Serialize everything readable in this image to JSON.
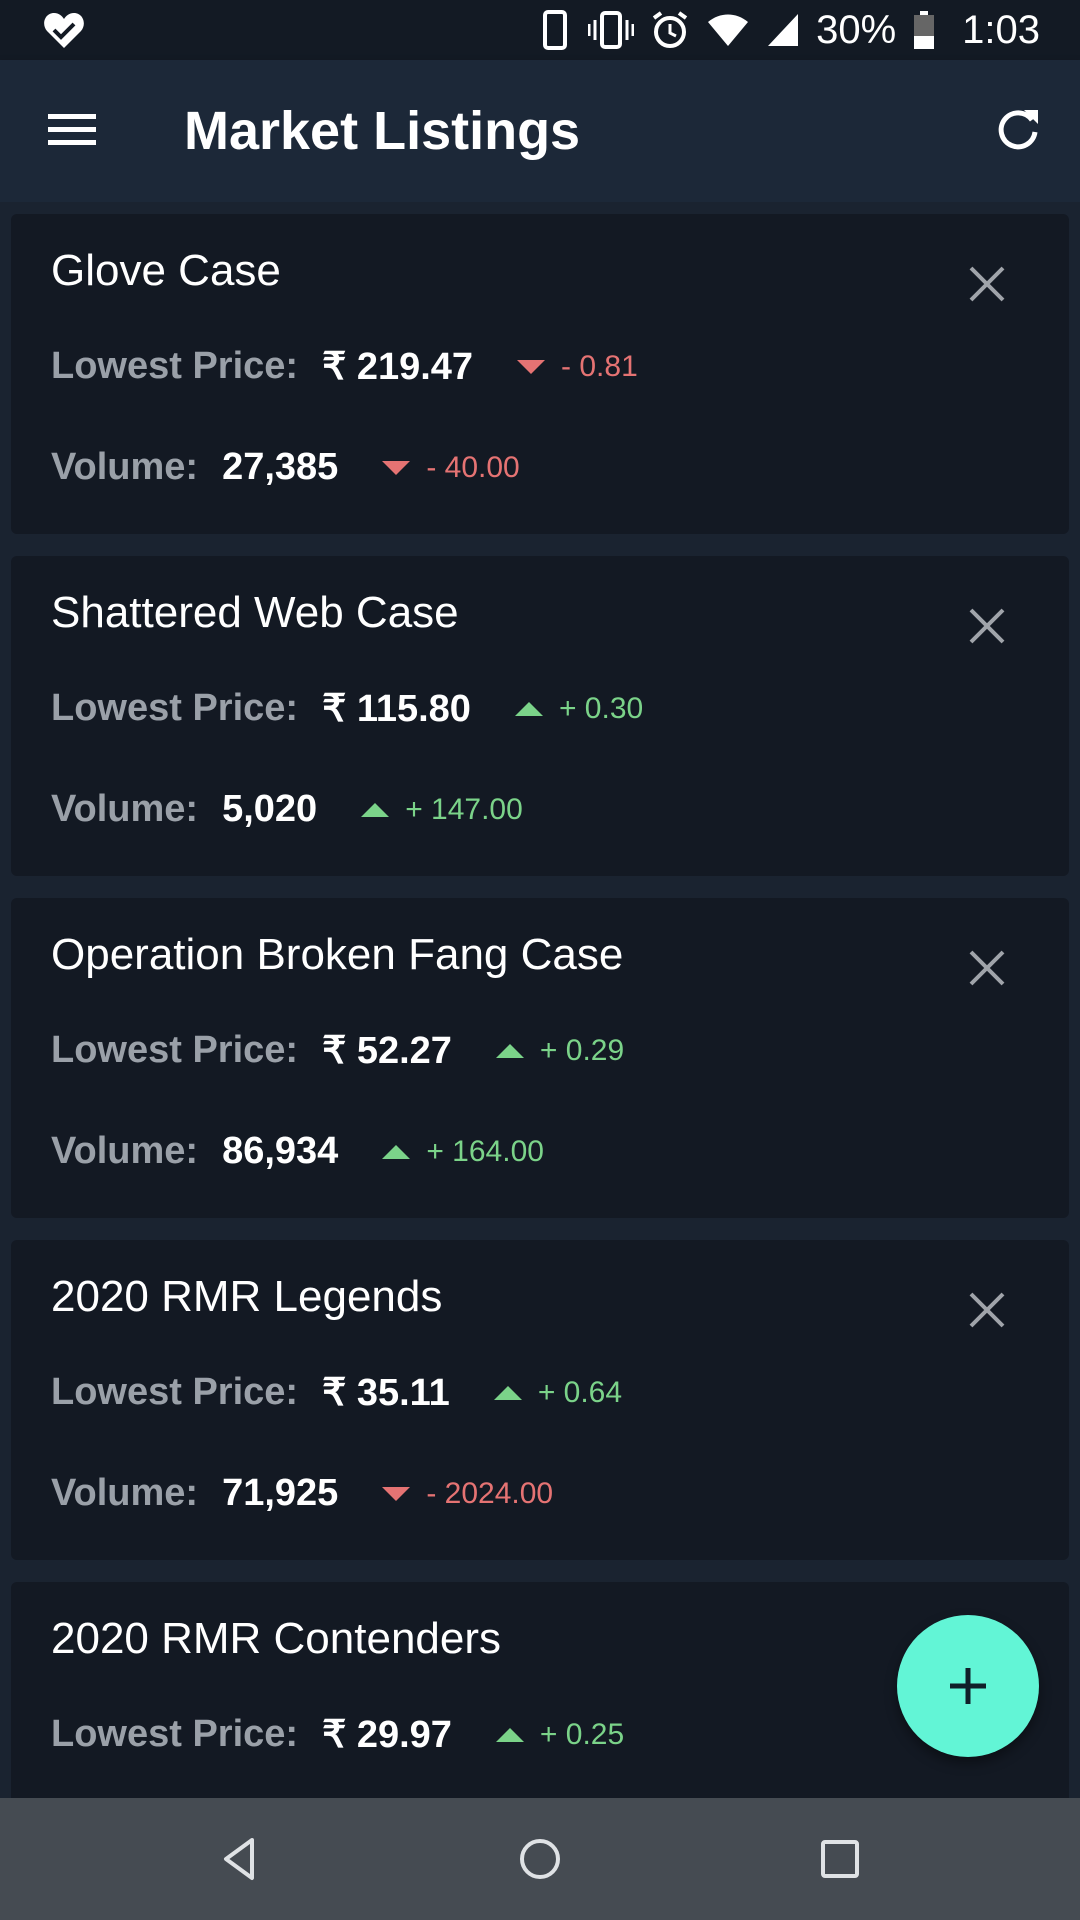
{
  "status_bar": {
    "battery": "30%",
    "time": "1:03",
    "icons": [
      "heart-check-icon",
      "phone-icon",
      "vibrate-icon",
      "alarm-icon",
      "wifi-icon",
      "signal-icon",
      "battery-icon"
    ]
  },
  "app_bar": {
    "title": "Market Listings",
    "menu_icon": "hamburger-menu-icon",
    "refresh_icon": "refresh-icon"
  },
  "labels": {
    "lowest_price": "Lowest Price:",
    "volume": "Volume:"
  },
  "colors": {
    "up": "#7bd389",
    "down": "#e57373",
    "fab": "#62f5d6"
  },
  "listings": [
    {
      "name": "Glove Case",
      "price": "₹ 219.47",
      "price_direction": "down",
      "price_change": "- 0.81",
      "volume": "27,385",
      "volume_direction": "down",
      "volume_change": "- 40.00"
    },
    {
      "name": "Shattered Web Case",
      "price": "₹ 115.80",
      "price_direction": "up",
      "price_change": "+ 0.30",
      "volume": "5,020",
      "volume_direction": "up",
      "volume_change": "+ 147.00"
    },
    {
      "name": "Operation Broken Fang Case",
      "price": "₹ 52.27",
      "price_direction": "up",
      "price_change": "+ 0.29",
      "volume": "86,934",
      "volume_direction": "up",
      "volume_change": "+ 164.00"
    },
    {
      "name": "2020 RMR Legends",
      "price": "₹ 35.11",
      "price_direction": "up",
      "price_change": "+ 0.64",
      "volume": "71,925",
      "volume_direction": "down",
      "volume_change": "- 2024.00"
    },
    {
      "name": "2020 RMR Contenders",
      "price": "₹ 29.97",
      "price_direction": "up",
      "price_change": "+ 0.25"
    }
  ],
  "fab": {
    "icon": "plus-icon"
  },
  "nav_bar": {
    "icons": [
      "back-icon",
      "home-icon",
      "recents-icon"
    ]
  }
}
